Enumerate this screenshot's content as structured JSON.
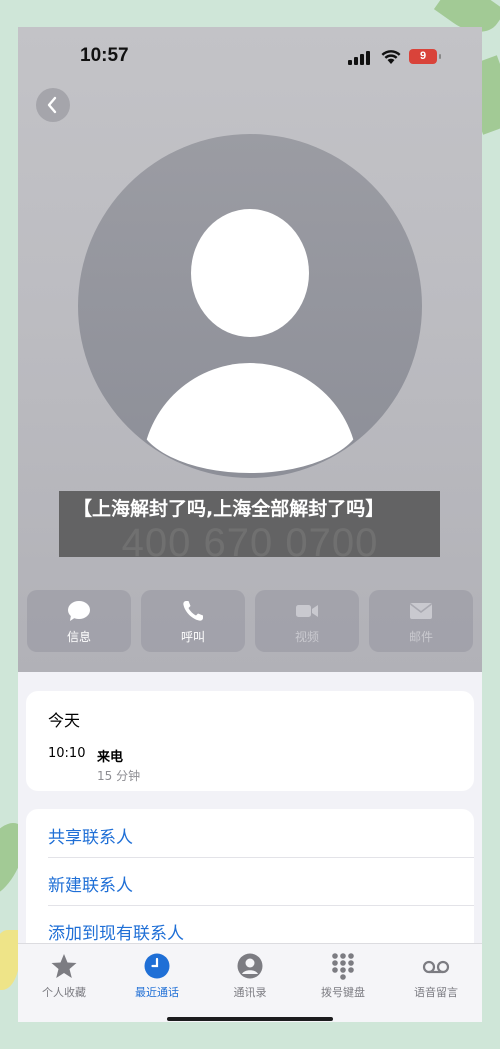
{
  "status_bar": {
    "time": "10:57",
    "battery": "9"
  },
  "contact": {
    "number": "400 670 0700"
  },
  "overlay": {
    "text": "【上海解封了吗,上海全部解封了吗】"
  },
  "actions": [
    {
      "label": "信息",
      "icon": "message-bubble-icon",
      "enabled": true
    },
    {
      "label": "呼叫",
      "icon": "phone-icon",
      "enabled": true
    },
    {
      "label": "视频",
      "icon": "video-camera-icon",
      "enabled": false
    },
    {
      "label": "邮件",
      "icon": "envelope-icon",
      "enabled": false
    }
  ],
  "recent_call": {
    "day": "今天",
    "time": "10:10",
    "type": "来电",
    "duration": "15 分钟"
  },
  "contact_links": [
    "共享联系人",
    "新建联系人",
    "添加到现有联系人"
  ],
  "tabs": [
    {
      "label": "个人收藏",
      "icon": "star-icon",
      "active": false
    },
    {
      "label": "最近通话",
      "icon": "clock-icon",
      "active": true
    },
    {
      "label": "通讯录",
      "icon": "person-circle-icon",
      "active": false
    },
    {
      "label": "拨号键盘",
      "icon": "keypad-icon",
      "active": false
    },
    {
      "label": "语音留言",
      "icon": "voicemail-icon",
      "active": false
    }
  ],
  "colors": {
    "accent": "#1f6fd6",
    "battery_low": "#d9433a"
  }
}
